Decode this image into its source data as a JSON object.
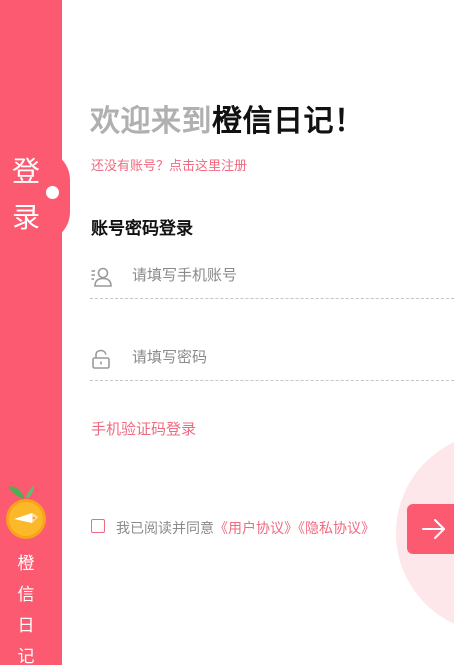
{
  "sidebar": {
    "login_chars": [
      "登",
      "录"
    ],
    "app_name_chars": [
      "橙",
      "信",
      "日",
      "记"
    ],
    "logo_icon": "orange-pen-logo"
  },
  "header": {
    "welcome_prefix": "欢迎来到",
    "welcome_app": "橙信日记",
    "welcome_suffix": "！"
  },
  "register_link": "还没有账号？点击这里注册",
  "section_title": "账号密码登录",
  "form": {
    "account": {
      "placeholder": "请填写手机账号",
      "value": "",
      "icon": "user-icon"
    },
    "password": {
      "placeholder": "请填写密码",
      "value": "",
      "icon": "lock-icon"
    }
  },
  "sms_login_link": "手机验证码登录",
  "agreement": {
    "checked": false,
    "prefix": "我已阅读并同意",
    "user_agreement": "《用户协议》",
    "privacy_policy": "《隐私协议》"
  },
  "submit": {
    "icon": "arrow-right-icon"
  },
  "colors": {
    "accent": "#fb5a70",
    "link": "#f06a80",
    "light_bg": "#fde7ea"
  }
}
